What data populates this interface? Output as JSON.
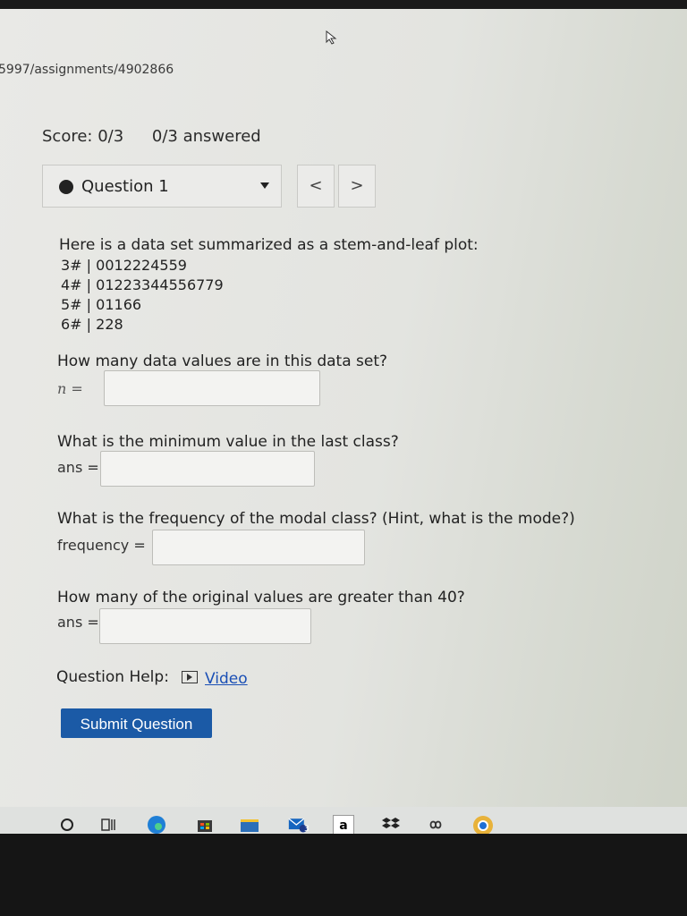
{
  "browser": {
    "url_fragment": "5997/assignments/4902866"
  },
  "header": {
    "score": "Score: 0/3",
    "answered": "0/3 answered"
  },
  "question_nav": {
    "label": "Question 1",
    "prev": "<",
    "next": ">"
  },
  "question": {
    "intro": "Here is a data set summarized as a stem-and-leaf plot:",
    "stem_rows": [
      "3# | 0012224559",
      "4# | 01223344556779",
      "5# | 01166",
      "6# | 228"
    ],
    "parts": [
      {
        "prompt": "How many data values are in this data set?",
        "label": "n =",
        "value": ""
      },
      {
        "prompt": "What is the minimum value in the last class?",
        "label": "ans =",
        "value": ""
      },
      {
        "prompt": "What is the frequency of the modal class? (Hint, what is the mode?)",
        "label": "frequency =",
        "value": ""
      },
      {
        "prompt": "How many of the original values are greater than 40?",
        "label": "ans =",
        "value": ""
      }
    ]
  },
  "help": {
    "label": "Question Help:",
    "video": "Video"
  },
  "submit_label": "Submit Question",
  "taskbar": {
    "icons": [
      "search-icon",
      "task-view-icon",
      "edge-icon",
      "store-icon",
      "file-explorer-icon",
      "mail-icon",
      "amazon-icon",
      "dropbox-icon",
      "infinity-icon",
      "chrome-icon",
      "help-icon"
    ],
    "mail_badge": "3",
    "amazon_letter": "a"
  }
}
